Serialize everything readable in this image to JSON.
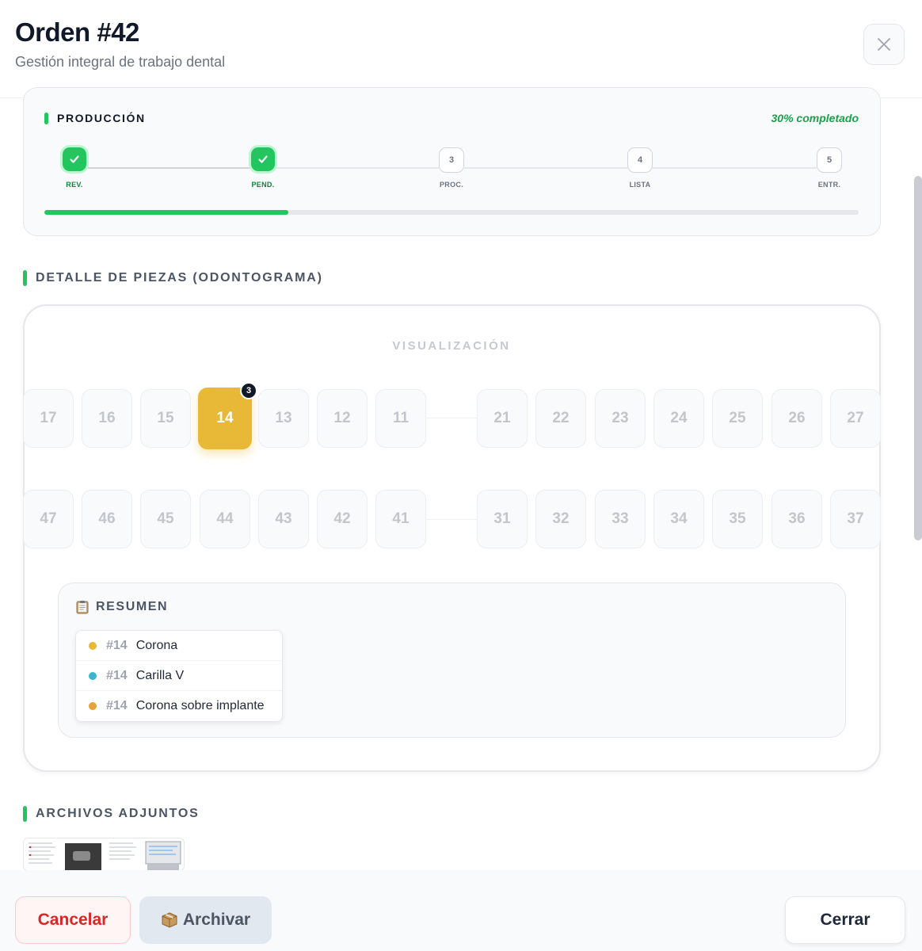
{
  "header": {
    "title": "Orden #42",
    "subtitle": "Gestión integral de trabajo dental",
    "close_icon": "close-icon"
  },
  "production": {
    "title": "PRODUCCIÓN",
    "percent_label": "30% completado",
    "progress_fraction": 0.3,
    "accent_color": "#22c55e",
    "steps": [
      {
        "label": "REV.",
        "number": "1",
        "status": "done"
      },
      {
        "label": "PEND.",
        "number": "2",
        "status": "done"
      },
      {
        "label": "PROC.",
        "number": "3",
        "status": "pending"
      },
      {
        "label": "LISTA",
        "number": "4",
        "status": "pending"
      },
      {
        "label": "ENTR.",
        "number": "5",
        "status": "pending"
      }
    ]
  },
  "odontogram": {
    "section_title": "DETALLE DE PIEZAS (ODONTOGRAMA)",
    "visualization_label": "VISUALIZACIÓN",
    "upper_left": [
      "17",
      "16",
      "15",
      "14",
      "13",
      "12",
      "11"
    ],
    "upper_right": [
      "21",
      "22",
      "23",
      "24",
      "25",
      "26",
      "27"
    ],
    "lower_left": [
      "47",
      "46",
      "45",
      "44",
      "43",
      "42",
      "41"
    ],
    "lower_right": [
      "31",
      "32",
      "33",
      "34",
      "35",
      "36",
      "37"
    ],
    "selected_tooth": "14",
    "selected_badge": "3",
    "selected_color": "#e8b936"
  },
  "summary": {
    "title": "RESUMEN",
    "icon": "clipboard-icon",
    "items": [
      {
        "tooth": "#14",
        "label": "Corona",
        "color": "#e8b936"
      },
      {
        "tooth": "#14",
        "label": "Carilla V",
        "color": "#3ab5cf"
      },
      {
        "tooth": "#14",
        "label": "Corona sobre implante",
        "color": "#e8a23a"
      }
    ]
  },
  "attachments": {
    "section_title": "ARCHIVOS ADJUNTOS"
  },
  "footer": {
    "cancel_label": "Cancelar",
    "archive_label": "Archivar",
    "archive_icon": "package-icon",
    "close_label": "Cerrar"
  }
}
